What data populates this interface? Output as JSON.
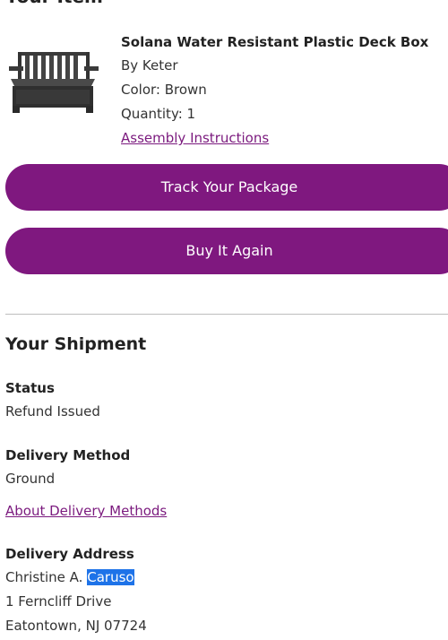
{
  "your_item": {
    "heading": "Your Item",
    "title": "Solana Water Resistant Plastic Deck Box",
    "brand": "By Keter",
    "color": "Color: Brown",
    "quantity": "Quantity: 1",
    "assembly_link": "Assembly Instructions",
    "image_icon": "deck-box-image"
  },
  "actions": {
    "track_label": "Track Your Package",
    "buy_again_label": "Buy It Again",
    "button_color": "#7f187f"
  },
  "shipment": {
    "heading": "Your Shipment",
    "status_label": "Status",
    "status_value": "Refund Issued",
    "delivery_method_label": "Delivery Method",
    "delivery_method_value": "Ground",
    "about_delivery_link": "About Delivery Methods",
    "address_label": "Delivery Address",
    "name_first": "Christine A.",
    "name_last": "Caruso",
    "street": "1 Ferncliff Drive",
    "city_line": "Eatontown, NJ 07724"
  },
  "colors": {
    "link": "#7b1a7e",
    "selection": "#1e73e8"
  }
}
